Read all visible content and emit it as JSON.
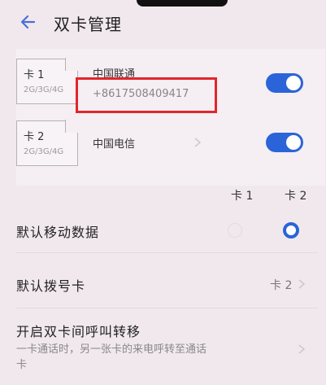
{
  "header": {
    "title": "双卡管理",
    "back_icon": "back-arrow-icon"
  },
  "sim_cards": [
    {
      "slot": "卡 1",
      "networks": "2G/3G/4G",
      "carrier": "中国联通",
      "phone": "+8617508409417",
      "enabled": true
    },
    {
      "slot": "卡 2",
      "networks": "2G/3G/4G",
      "carrier": "中国电信",
      "phone": "",
      "enabled": true
    }
  ],
  "columns": {
    "card1": "卡 1",
    "card2": "卡 2"
  },
  "settings": {
    "default_data": {
      "label": "默认移动数据",
      "selected": "卡 2"
    },
    "default_dial": {
      "label": "默认拨号卡",
      "value": "卡 2"
    },
    "call_forward": {
      "label": "开启双卡间呼叫转移",
      "description": "一卡通话时，另一张卡的来电呼转至通话卡"
    }
  },
  "colors": {
    "accent": "#2b64d8",
    "highlight": "#e1262b",
    "background": "#f1e8ee"
  }
}
